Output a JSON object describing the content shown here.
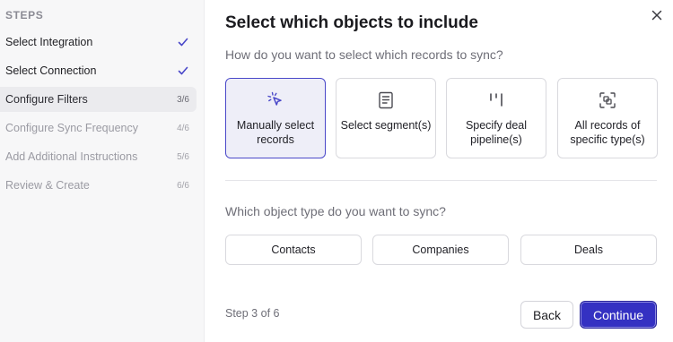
{
  "sidebar": {
    "heading": "STEPS",
    "steps": [
      {
        "label": "Select Integration",
        "status": "done"
      },
      {
        "label": "Select Connection",
        "status": "done"
      },
      {
        "label": "Configure Filters",
        "status": "active",
        "count": "3/6"
      },
      {
        "label": "Configure Sync Frequency",
        "status": "pending",
        "count": "4/6"
      },
      {
        "label": "Add Additional Instructions",
        "status": "pending",
        "count": "5/6"
      },
      {
        "label": "Review & Create",
        "status": "pending",
        "count": "6/6"
      }
    ]
  },
  "main": {
    "title": "Select which objects to include",
    "question1": "How do you want to select which records to sync?",
    "options": [
      {
        "label": "Manually select records",
        "icon": "cursor-click-icon",
        "selected": true
      },
      {
        "label": "Select segment(s)",
        "icon": "document-list-icon",
        "selected": false
      },
      {
        "label": "Specify deal pipeline(s)",
        "icon": "pipeline-columns-icon",
        "selected": false
      },
      {
        "label": "All records of specific type(s)",
        "icon": "scan-square-icon",
        "selected": false
      }
    ],
    "question2": "Which object type do you want to sync?",
    "object_types": [
      "Contacts",
      "Companies",
      "Deals"
    ]
  },
  "footer": {
    "step_indicator": "Step 3 of 6",
    "back_label": "Back",
    "continue_label": "Continue"
  },
  "colors": {
    "accent": "#3431c2",
    "selected_bg": "#eeeef8",
    "check": "#4a48c9"
  }
}
